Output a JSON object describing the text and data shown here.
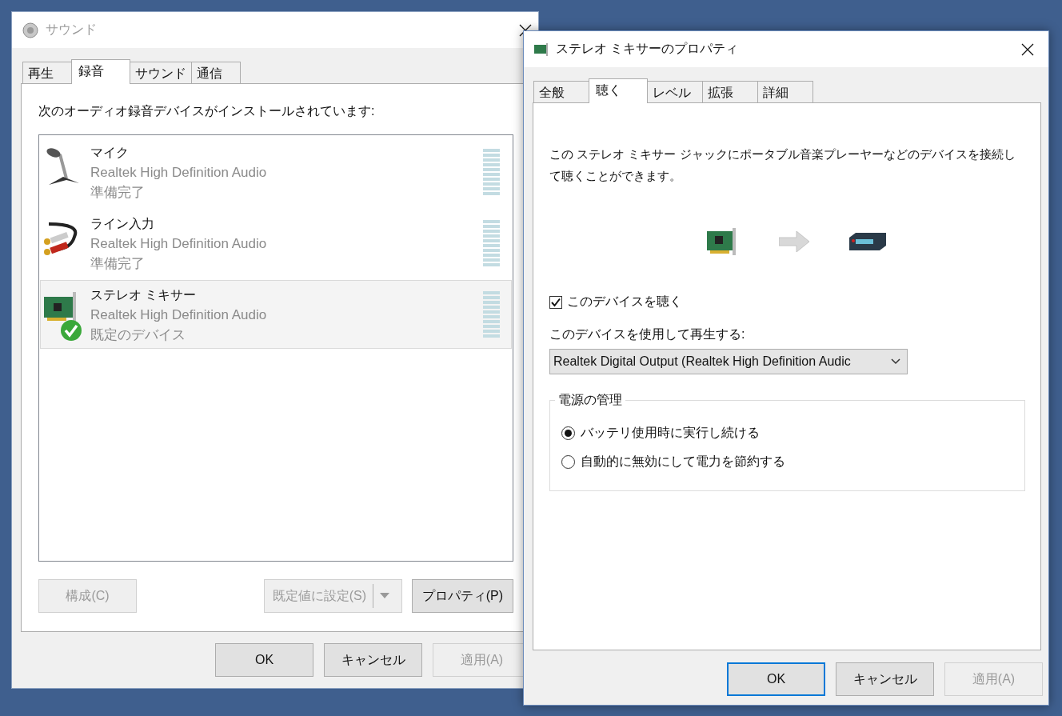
{
  "sound_window": {
    "title": "サウンド",
    "tabs": [
      {
        "label": "再生",
        "selected": false
      },
      {
        "label": "録音",
        "selected": true
      },
      {
        "label": "サウンド",
        "selected": false
      },
      {
        "label": "通信",
        "selected": false
      }
    ],
    "instruction": "次のオーディオ録音デバイスがインストールされています:",
    "devices": [
      {
        "kind": "microphone",
        "name": "マイク",
        "driver": "Realtek High Definition Audio",
        "status": "準備完了",
        "selected": false,
        "default": false
      },
      {
        "kind": "line-in",
        "name": "ライン入力",
        "driver": "Realtek High Definition Audio",
        "status": "準備完了",
        "selected": false,
        "default": false
      },
      {
        "kind": "sound-card",
        "name": "ステレオ ミキサー",
        "driver": "Realtek High Definition Audio",
        "status": "既定のデバイス",
        "selected": true,
        "default": true
      }
    ],
    "configure_button": {
      "label": "構成(C)",
      "disabled": true
    },
    "set_default_button": {
      "label": "既定値に設定(S)",
      "disabled": true
    },
    "properties_button": {
      "label": "プロパティ(P)",
      "disabled": false
    },
    "footer_buttons": [
      {
        "label": "OK",
        "disabled": false,
        "default": false
      },
      {
        "label": "キャンセル",
        "disabled": false,
        "default": false
      },
      {
        "label": "適用(A)",
        "disabled": true,
        "default": false
      }
    ]
  },
  "properties_window": {
    "title": "ステレオ ミキサーのプロパティ",
    "tabs": [
      {
        "label": "全般",
        "selected": false
      },
      {
        "label": "聴く",
        "selected": true
      },
      {
        "label": "レベル",
        "selected": false
      },
      {
        "label": "拡張",
        "selected": false
      },
      {
        "label": "詳細",
        "selected": false
      }
    ],
    "description": "この ステレオ ミキサー ジャックにポータブル音楽プレーヤーなどのデバイスを接続して聴くことができます。",
    "listen_checkbox": {
      "label": "このデバイスを聴く",
      "checked": true
    },
    "playback_label": "このデバイスを使用して再生する:",
    "playback_device": "Realtek Digital Output (Realtek High Definition Audic",
    "power_group": {
      "title": "電源の管理",
      "options": [
        {
          "label": "バッテリ使用時に実行し続ける",
          "selected": true
        },
        {
          "label": "自動的に無効にして電力を節約する",
          "selected": false
        }
      ]
    },
    "footer_buttons": [
      {
        "label": "OK",
        "disabled": false,
        "default": true
      },
      {
        "label": "キャンセル",
        "disabled": false,
        "default": false
      },
      {
        "label": "適用(A)",
        "disabled": true,
        "default": false
      }
    ]
  }
}
